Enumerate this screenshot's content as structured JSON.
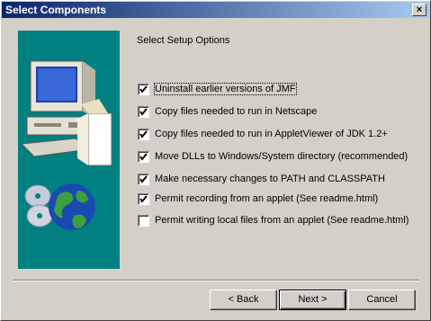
{
  "window": {
    "title": "Select Components",
    "close_label": "×"
  },
  "heading": "Select Setup Options",
  "options": [
    {
      "label": "Uninstall earlier versions of JMF",
      "checked": true
    },
    {
      "label": "Copy files needed to run in Netscape",
      "checked": true
    },
    {
      "label": "Copy files needed to run in AppletViewer of JDK 1.2+",
      "checked": true
    },
    {
      "label": "Move DLLs to Windows/System directory (recommended)",
      "checked": true
    },
    {
      "label": "Make necessary changes to PATH and CLASSPATH",
      "checked": true
    },
    {
      "label": "Permit recording from an applet (See readme.html)",
      "checked": true
    },
    {
      "label": "Permit writing local files from an applet (See readme.html)",
      "checked": false
    }
  ],
  "buttons": {
    "back": "< Back",
    "next": "Next >",
    "cancel": "Cancel"
  },
  "colors": {
    "titlebar_start": "#0a246a",
    "titlebar_end": "#a6caf0",
    "panel": "#008080",
    "face": "#d4d0c8"
  }
}
